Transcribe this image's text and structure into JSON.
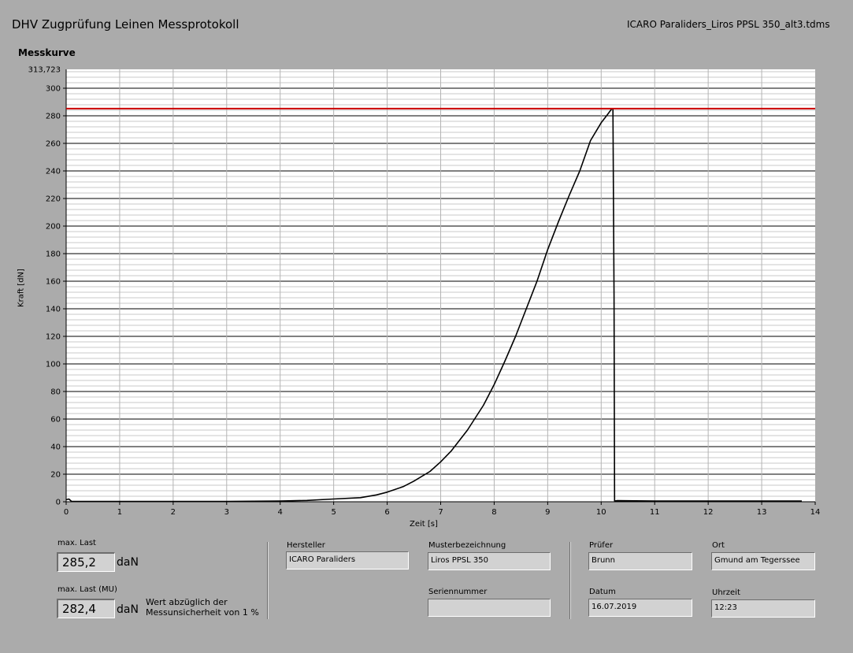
{
  "header": {
    "title": "DHV Zugprüfung Leinen Messprotokoll",
    "filename": "ICARO Paraliders_Liros PPSL 350_alt3.tdms"
  },
  "chart_data": {
    "type": "line",
    "title": "Messkurve",
    "xlabel": "Zeit [s]",
    "ylabel": "Kraft [dN]",
    "xlim": [
      0,
      14
    ],
    "ylim": [
      0,
      313.723
    ],
    "ymax_label": "313,723",
    "x_ticks": [
      "0",
      "1",
      "2",
      "3",
      "4",
      "5",
      "6",
      "7",
      "8",
      "9",
      "10",
      "11",
      "12",
      "13",
      "14"
    ],
    "y_ticks": [
      "0",
      "20",
      "40",
      "60",
      "80",
      "100",
      "120",
      "140",
      "160",
      "180",
      "200",
      "220",
      "240",
      "260",
      "280",
      "300"
    ],
    "grid": true,
    "series": [
      {
        "color": "#000000",
        "x": [
          0,
          0.05,
          0.1,
          1,
          2,
          3,
          4,
          4.5,
          5,
          5.5,
          5.8,
          6,
          6.3,
          6.5,
          6.8,
          7,
          7.2,
          7.5,
          7.8,
          8,
          8.2,
          8.4,
          8.6,
          8.8,
          9,
          9.2,
          9.4,
          9.6,
          9.8,
          10,
          10.1,
          10.2,
          10.22,
          10.24,
          10.25,
          10.3,
          11,
          12,
          13,
          13.75
        ],
        "y": [
          1.5,
          2,
          0.3,
          0.3,
          0.3,
          0.3,
          0.5,
          1,
          2,
          3,
          5,
          7,
          11,
          15,
          22,
          29,
          37,
          52,
          70,
          85,
          102,
          120,
          140,
          160,
          183,
          203,
          222,
          240,
          262,
          275,
          280,
          285.2,
          285,
          150,
          0.5,
          0.8,
          0.5,
          0.5,
          0.5,
          0.5
        ]
      },
      {
        "color": "#cc0000",
        "x": [
          0,
          14
        ],
        "y": [
          285.2,
          285.2
        ]
      }
    ]
  },
  "fields": {
    "max_last_label": "max. Last",
    "max_last_value": "285,2",
    "max_last_unit": "daN",
    "max_last_mu_label": "max. Last (MU)",
    "max_last_mu_value": "282,4",
    "max_last_mu_unit": "daN",
    "note": "Wert abzüglich der Messunsicherheit von 1 %",
    "hersteller_label": "Hersteller",
    "hersteller_value": "ICARO Paraliders",
    "muster_label": "Musterbezeichnung",
    "muster_value": "Liros PPSL 350",
    "serien_label": "Seriennummer",
    "serien_value": "",
    "pruefer_label": "Prüfer",
    "pruefer_value": "Brunn",
    "datum_label": "Datum",
    "datum_value": "16.07.2019",
    "ort_label": "Ort",
    "ort_value": "Gmund am Tegerssee",
    "uhrzeit_label": "Uhrzeit",
    "uhrzeit_value": "12:23"
  }
}
